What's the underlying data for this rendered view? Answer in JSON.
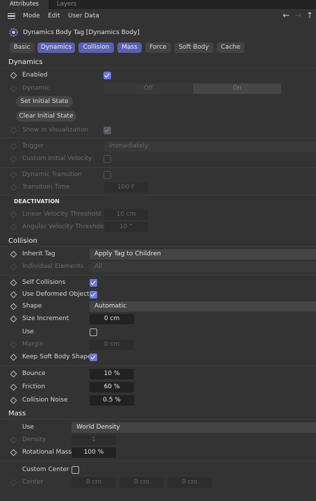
{
  "tabs": [
    {
      "label": "Attributes",
      "active": true
    },
    {
      "label": "Layers",
      "active": false
    }
  ],
  "menu": {
    "mode": "Mode",
    "edit": "Edit",
    "user_data": "User Data"
  },
  "nav": {
    "back": "←",
    "forward": "→",
    "up": "↑"
  },
  "tag_title": "Dynamics Body Tag [Dynamics Body]",
  "tag_buttons": [
    {
      "label": "Basic",
      "active": false
    },
    {
      "label": "Dynamics",
      "active": true
    },
    {
      "label": "Collision",
      "active": true
    },
    {
      "label": "Mass",
      "active": true
    },
    {
      "label": "Force",
      "active": false
    },
    {
      "label": "Soft Body",
      "active": false
    },
    {
      "label": "Cache",
      "active": false
    }
  ],
  "colors": {
    "accent": "#5b5fb4",
    "checkbox": "#6b79d8",
    "background": "#333333",
    "field": "#222222"
  },
  "dynamics": {
    "header": "Dynamics",
    "enabled": {
      "label": "Enabled",
      "checked": true
    },
    "dynamic": {
      "label": "Dynamic",
      "off": "Off",
      "on": "On"
    },
    "set_initial_state": "Set Initial State",
    "clear_initial_state": "Clear Initial State",
    "show_in_visualization": {
      "label": "Show in Visualization",
      "checked": true
    },
    "trigger": {
      "label": "Trigger",
      "value": "Immediately"
    },
    "custom_initial_velocity": {
      "label": "Custom Initial Velocity",
      "checked": false
    },
    "dynamic_transition": {
      "label": "Dynamic Transition",
      "checked": false
    },
    "transition_time": {
      "label": "Transition Time",
      "value": "100 F"
    },
    "deactivation_header": "DEACTIVATION",
    "linear_velocity_threshold": {
      "label": "Linear Velocity Threshold",
      "value": "10 cm"
    },
    "angular_velocity_threshold": {
      "label": "Angular Velocity Threshold",
      "value": "10 °"
    }
  },
  "collision": {
    "header": "Collision",
    "inherit_tag": {
      "label": "Inherit Tag",
      "value": "Apply Tag to Children"
    },
    "individual_elements": {
      "label": "Individual Elements",
      "value": "All"
    },
    "self_collisions": {
      "label": "Self Collisions",
      "checked": true
    },
    "use_deformed_object": {
      "label": "Use Deformed Object",
      "checked": true
    },
    "shape": {
      "label": "Shape",
      "value": "Automatic"
    },
    "size_increment": {
      "label": "Size Increment",
      "value": "0 cm"
    },
    "use": {
      "label": "Use",
      "checked": false
    },
    "margin": {
      "label": "Margin",
      "value": "0 cm"
    },
    "keep_soft_body_shape": {
      "label": "Keep Soft Body Shape",
      "checked": true
    },
    "bounce": {
      "label": "Bounce",
      "value": "10 %"
    },
    "friction": {
      "label": "Friction",
      "value": "60 %"
    },
    "collision_noise": {
      "label": "Collision Noise",
      "value": "0.5 %"
    }
  },
  "mass": {
    "header": "Mass",
    "use": {
      "label": "Use",
      "value": "World Density"
    },
    "density": {
      "label": "Density",
      "value": "1"
    },
    "rotational_mass": {
      "label": "Rotational Mass",
      "value": "100 %"
    },
    "custom_center": {
      "label": "Custom Center",
      "checked": false
    },
    "center": {
      "label": "Center",
      "x": "0 cm",
      "y": "0 cm",
      "z": "0 cm"
    }
  }
}
